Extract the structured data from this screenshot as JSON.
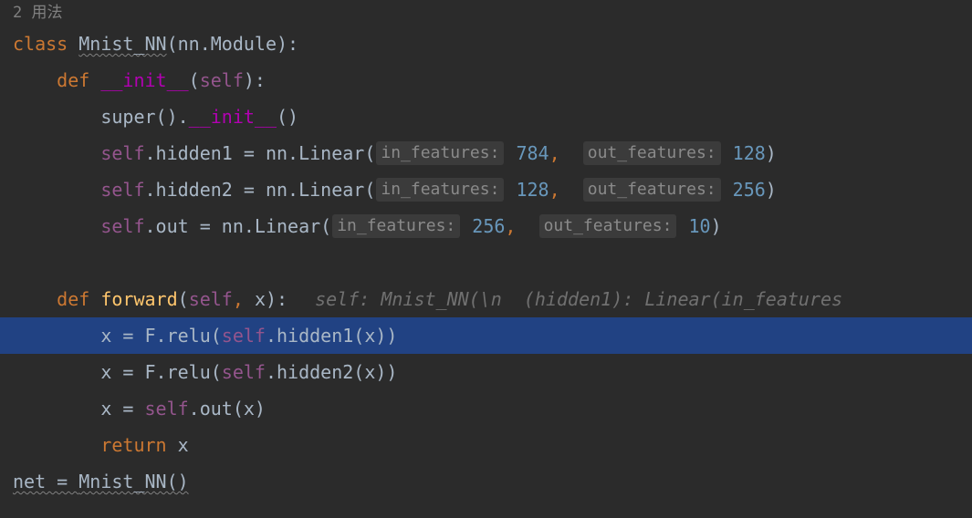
{
  "header": {
    "usages": "2 用法"
  },
  "code": {
    "class_kw": "class",
    "class_name": "Mnist_NN",
    "nn_module": "nn.Module",
    "def_kw": "def",
    "dunder_init": "__init__",
    "self_kw": "self",
    "super_call_a": "super().",
    "super_call_b": "()",
    "hidden1_assign_left": ".hidden1 = nn.Linear(",
    "hidden2_assign_left": ".hidden2 = nn.Linear(",
    "out_assign_left": ".out = nn.Linear(",
    "in_feat_label": "in_features:",
    "out_feat_label": "out_features:",
    "h1_in": "784",
    "h1_out": "128",
    "h2_in": "128",
    "h2_out": "256",
    "o_in": "256",
    "o_out": "10",
    "forward_name": "forward",
    "forward_params_comma": ", ",
    "x_param": "x",
    "inlay_forward": "self: Mnist_NN(\\n  (hidden1): Linear(in_features",
    "fwd1_a": "x = F.relu(",
    "fwd1_b": ".hidden1(x))",
    "fwd2_a": "x = F.relu(",
    "fwd2_b": ".hidden2(x))",
    "fwd3_a": "x = ",
    "fwd3_b": ".out(x)",
    "return_kw": "return",
    "return_x": " x",
    "net_assign_a": "net = ",
    "net_assign_b": "Mnist_NN()"
  }
}
